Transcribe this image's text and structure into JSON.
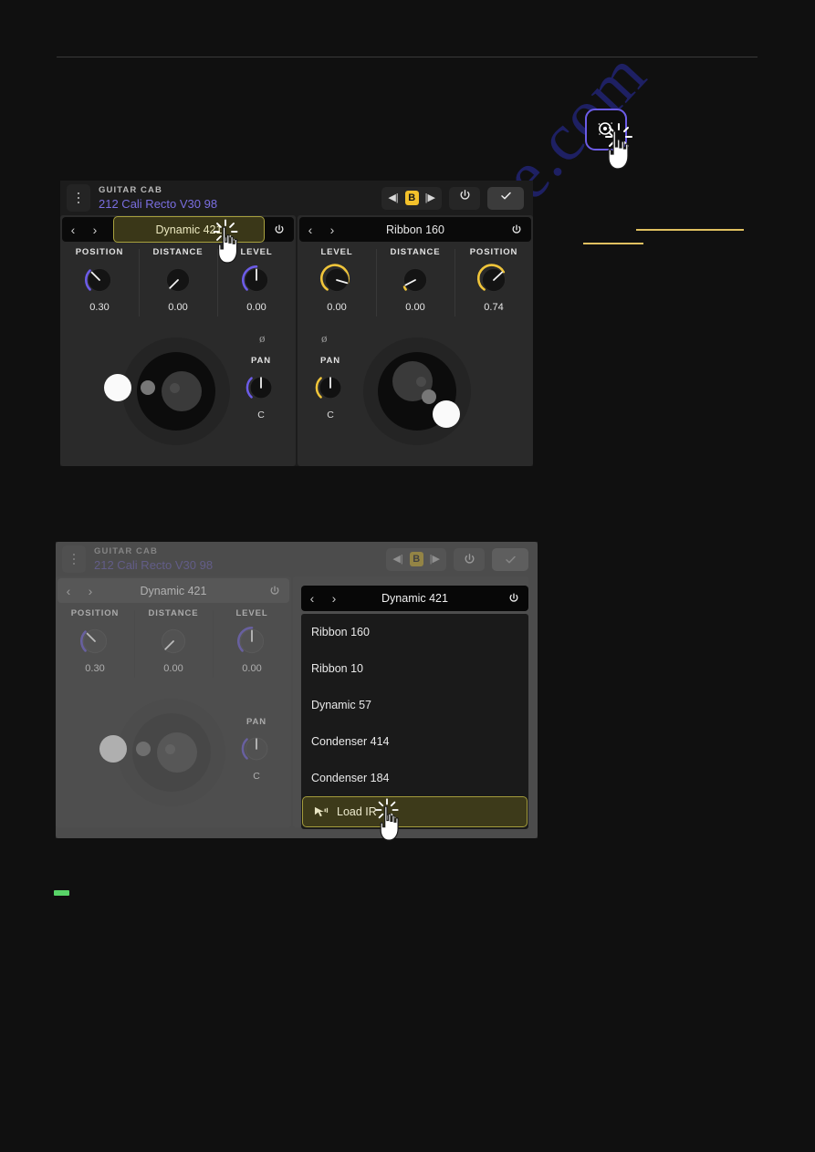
{
  "app": {
    "eyebrow": "GUITAR CAB",
    "preset_name": "212 Cali Recto V30 98"
  },
  "toolbar": {
    "prev_label": "◀|",
    "slot_label": "B",
    "next_label": "|▶",
    "power_icon": "power-icon",
    "confirm_icon": "check-icon"
  },
  "search_button": {
    "icon": "magnifier-sparkle-icon"
  },
  "mic_a": {
    "name": "Dynamic 421",
    "prev": "‹",
    "next": "›",
    "power_icon": "power-icon",
    "phase_icon": "ø",
    "knobs": [
      {
        "label": "POSITION",
        "value": "0.30",
        "arc": 0.3,
        "color": "#6c5ce7"
      },
      {
        "label": "DISTANCE",
        "value": "0.00",
        "arc": 0.0,
        "color": "#6c5ce7"
      },
      {
        "label": "LEVEL",
        "value": "0.00",
        "arc": 0.62,
        "color": "#6c5ce7"
      }
    ],
    "pan": {
      "label": "PAN",
      "value": "C",
      "arc": 0.5,
      "color": "#6c5ce7"
    }
  },
  "mic_b": {
    "name": "Ribbon 160",
    "prev": "‹",
    "next": "›",
    "power_icon": "power-icon",
    "phase_icon": "ø",
    "knobs": [
      {
        "label": "LEVEL",
        "value": "0.00",
        "arc": 0.6,
        "color": "#f0c53a"
      },
      {
        "label": "DISTANCE",
        "value": "0.00",
        "arc": 0.06,
        "color": "#f0c53a"
      },
      {
        "label": "POSITION",
        "value": "0.74",
        "arc": 0.74,
        "color": "#f0c53a"
      }
    ],
    "pan": {
      "label": "PAN",
      "value": "C",
      "arc": 0.5,
      "color": "#f0c53a"
    }
  },
  "dropdown": {
    "title": "Dynamic 421",
    "prev": "‹",
    "next": "›",
    "power_icon": "power-icon",
    "items": [
      "Ribbon 160",
      "Ribbon 10",
      "Dynamic 57",
      "Condenser 414",
      "Condenser 184"
    ],
    "load_ir": {
      "label": "Load IR",
      "icon": "load-ir-icon"
    }
  },
  "watermark": {
    "text": "manualslive.com"
  },
  "colors": {
    "accent_purple": "#6c5ce7",
    "accent_yellow": "#f0c53a",
    "highlight_border": "#a8a13e",
    "highlight_fill": "#3a3718",
    "green_marker": "#58d468",
    "gold_line": "#e0c060"
  }
}
